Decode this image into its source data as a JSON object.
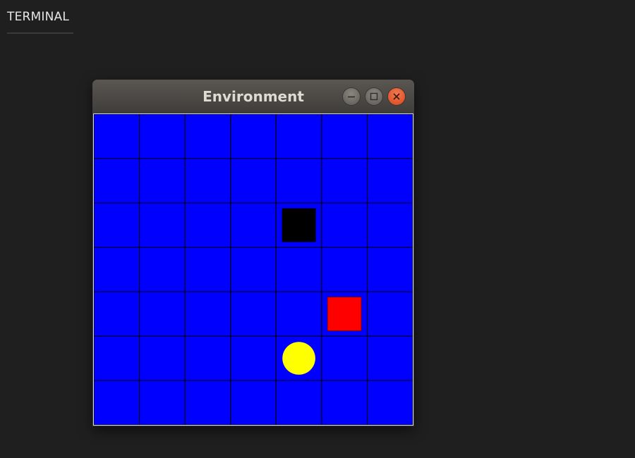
{
  "panel": {
    "tab_label": "TERMINAL"
  },
  "window": {
    "title": "Environment",
    "buttons": {
      "minimize": "minimize",
      "maximize": "maximize",
      "close": "close"
    }
  },
  "environment": {
    "rows": 7,
    "cols": 7,
    "background_color": "#0000ff",
    "grid_line_color": "#000000",
    "objects": [
      {
        "kind": "obstacle",
        "shape": "square",
        "row": 2,
        "col": 4,
        "color": "#000000"
      },
      {
        "kind": "goal",
        "shape": "square",
        "row": 4,
        "col": 5,
        "color": "#ff0000"
      },
      {
        "kind": "agent",
        "shape": "circle",
        "row": 5,
        "col": 4,
        "color": "#ffff00"
      }
    ]
  }
}
